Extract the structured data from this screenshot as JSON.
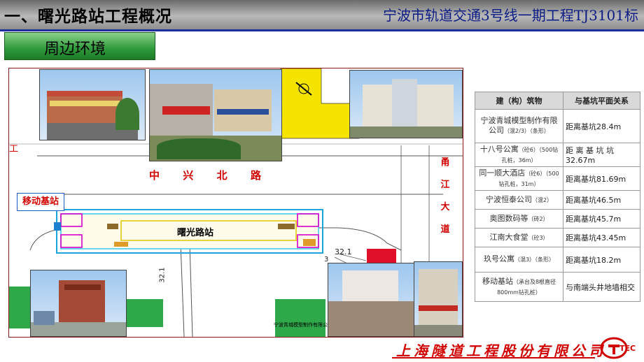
{
  "header": {
    "title": "一、曙光路站工程概况",
    "project": "宁波市轨道交通3号线一期工程TJ3101标"
  },
  "section": {
    "tab_label": "周边环境"
  },
  "map": {
    "road_label": "中 兴 北 路",
    "road_chars": [
      "中",
      "兴",
      "北",
      "路"
    ],
    "east_road_chars": [
      "甬",
      "江",
      "大",
      "道"
    ],
    "station_label": "曙光路站",
    "callout": "移动基站",
    "dim_1": "32.1",
    "dim_2": "32.1",
    "dim_3": "3",
    "building_label_1": "宁波青城模型制作有限公司",
    "building_label_2": "同一顺大酒店",
    "left_edge_char": "工"
  },
  "table": {
    "headers": [
      "建（构）筑物",
      "与基坑平面关系"
    ],
    "rows": [
      {
        "name": "宁波青城模型制作有限公司",
        "note": "（混2/3）（条形）",
        "relation": "距离基坑28.4m"
      },
      {
        "name": "十八号公寓",
        "note": "（砼6）（500钻孔桩，36m）",
        "relation": "距 离 基 坑 坑 32.67m"
      },
      {
        "name": "同一顺大酒店",
        "note": "（砼6）（500钻孔桩，31m）",
        "relation": "距离基坑81.69m"
      },
      {
        "name": "宁波恒泰公司",
        "note": "（混2）",
        "relation": "距离基坑46.5m"
      },
      {
        "name": "奥图数码等",
        "note": "（砖2）",
        "relation": "距离基坑45.7m"
      },
      {
        "name": "江南大食堂",
        "note": "（砼3）",
        "relation": "距离基坑43.45m"
      },
      {
        "name": "玖号公寓",
        "note": "（混3）（条形）",
        "relation": "距离基坑18.2m"
      },
      {
        "name": "移动基站",
        "note": "（承台及8根直径800mm钻孔桩）",
        "relation": "与南端头井地墙相交"
      }
    ]
  },
  "footer": {
    "company": "上海隧道工程股份有限公司",
    "logo_text": "TEC"
  },
  "colors": {
    "accent_blue": "#1c2f9a",
    "brand_red": "#d10000",
    "tab_green": "#2f9a3a"
  }
}
